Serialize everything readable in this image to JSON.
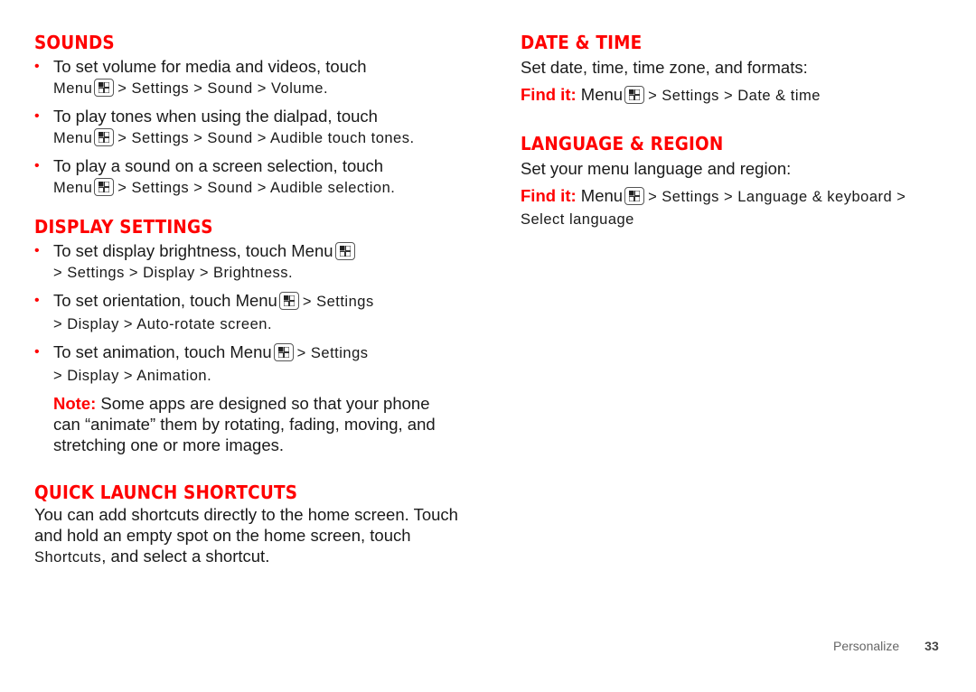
{
  "left": {
    "sounds": {
      "title": "SOUNDS",
      "items": [
        {
          "text": "To set volume for media and videos, touch",
          "menu": "Menu",
          "path": "> Settings > Sound > Volume."
        },
        {
          "text": "To play tones when using the dialpad, touch",
          "menu": "Menu",
          "path": "> Settings > Sound > Audible touch tones."
        },
        {
          "text": "To play a sound on a screen selection, touch",
          "menu": "Menu",
          "path": "> Settings > Sound > Audible selection."
        }
      ]
    },
    "display": {
      "title": "DISPLAY SETTINGS",
      "items": [
        {
          "text": "To set display brightness, touch Menu",
          "path": "> Settings > Display > Brightness."
        },
        {
          "text": "To set orientation, touch Menu",
          "path1": "> Settings",
          "path2": "> Display > Auto-rotate screen."
        },
        {
          "text": "To set animation, touch Menu",
          "path1": "> Settings",
          "path2": "> Display > Animation."
        }
      ],
      "note_label": "Note:",
      "note_text": "Some apps are designed so that your phone can “animate” them by rotating, fading, moving, and stretching one or more images."
    },
    "quick": {
      "title": "QUICK LAUNCH SHORTCUTS",
      "text1": "You can add shortcuts directly to the home screen. Touch and hold an empty spot on the home screen, touch",
      "shortcuts": "Shortcuts",
      "text2": ", and select a shortcut."
    }
  },
  "right": {
    "datetime": {
      "title": "DATE & TIME",
      "desc": "Set date, time, time zone, and formats:",
      "findit_label": "Find it:",
      "menu": "Menu",
      "path": "> Settings > Date & time"
    },
    "language": {
      "title": "LANGUAGE & REGION",
      "desc": "Set your menu language and region:",
      "findit_label": "Find it:",
      "menu": "Menu",
      "path": "> Settings > Language & keyboard > Select language"
    }
  },
  "footer": {
    "section": "Personalize",
    "page": "33"
  },
  "colors": {
    "accent": "#ff0000",
    "text": "#1a1a1a"
  }
}
